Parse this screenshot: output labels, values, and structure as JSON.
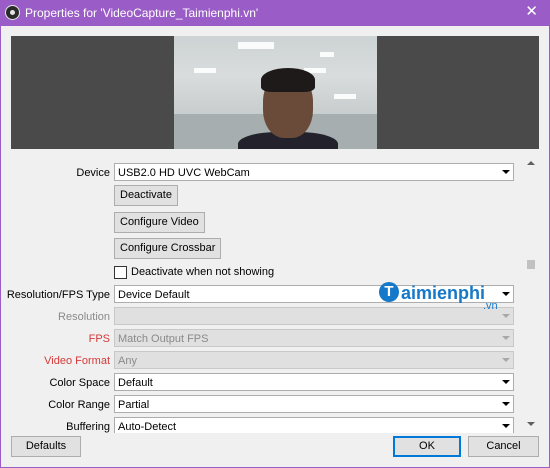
{
  "window": {
    "title": "Properties for 'VideoCapture_Taimienphi.vn'",
    "close_glyph": "✕"
  },
  "fields": {
    "device": {
      "label": "Device",
      "value": "USB2.0 HD UVC WebCam"
    },
    "deactivate_button": "Deactivate",
    "configure_video_button": "Configure Video",
    "configure_crossbar_button": "Configure Crossbar",
    "deactivate_when_not_showing": {
      "label": "Deactivate when not showing",
      "checked": false
    },
    "resolution_fps_type": {
      "label": "Resolution/FPS Type",
      "value": "Device Default"
    },
    "resolution": {
      "label": "Resolution",
      "value": ""
    },
    "fps": {
      "label": "FPS",
      "value": "Match Output FPS"
    },
    "video_format": {
      "label": "Video Format",
      "value": "Any"
    },
    "color_space": {
      "label": "Color Space",
      "value": "Default"
    },
    "color_range": {
      "label": "Color Range",
      "value": "Partial"
    },
    "buffering": {
      "label": "Buffering",
      "value": "Auto-Detect"
    }
  },
  "watermark": {
    "letter": "T",
    "name": "aimienphi",
    "suffix": ".vn"
  },
  "footer": {
    "defaults": "Defaults",
    "ok": "OK",
    "cancel": "Cancel"
  },
  "colors": {
    "titlebar": "#9a5cc6",
    "label_red": "#d43a3a",
    "watermark": "#1678c8"
  }
}
